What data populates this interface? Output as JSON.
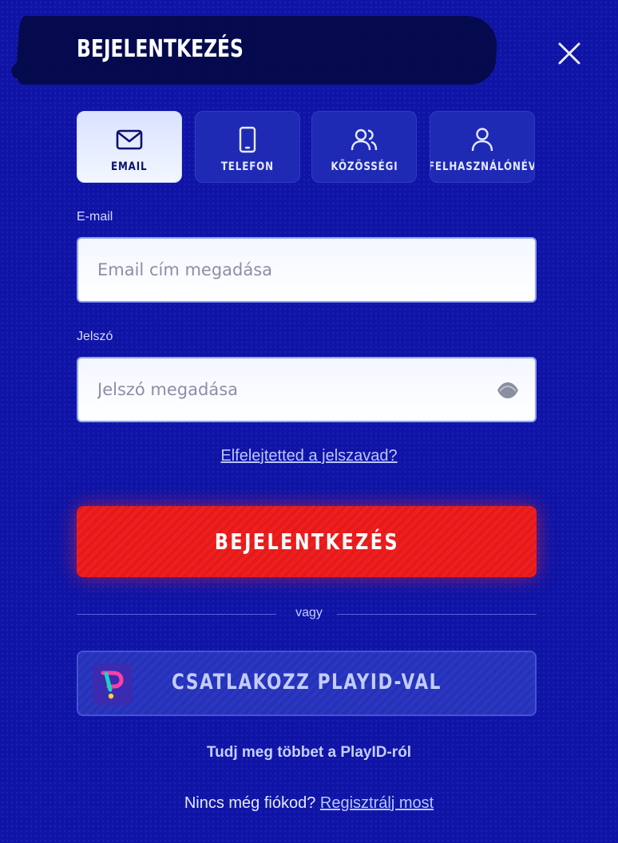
{
  "header": {
    "title": "BEJELENTKEZÉS",
    "close_icon": "close-icon"
  },
  "tabs": [
    {
      "label": "EMAIL",
      "icon": "mail-icon",
      "active": true
    },
    {
      "label": "TELEFON",
      "icon": "phone-icon",
      "active": false
    },
    {
      "label": "KÖZÖSSÉGI",
      "icon": "users-icon",
      "active": false
    },
    {
      "label": "FELHASZNÁLÓNÉV",
      "icon": "user-icon",
      "active": false
    }
  ],
  "form": {
    "email_label": "E-mail",
    "email_placeholder": "Email cím megadása",
    "email_value": "",
    "password_label": "Jelszó",
    "password_placeholder": "Jelszó megadása",
    "password_value": "",
    "eye_icon": "eye-icon",
    "forgot_link": "Elfelejtetted a jelszavad?",
    "login_button": "BEJELENTKEZÉS"
  },
  "divider": {
    "text": "vagy"
  },
  "playid": {
    "button_label": "CSATLAKOZZ PLAYID-VAL",
    "logo_icon": "playid-logo-icon",
    "learn_more": "Tudj meg többet a PlayID-ról"
  },
  "register": {
    "prompt": "Nincs még fiókod?",
    "link": "Regisztrálj most"
  },
  "colors": {
    "background": "#0f14a6",
    "primary_button": "#ee1f1f",
    "active_tab": "#e3eaff",
    "link": "#b9c6ff"
  }
}
